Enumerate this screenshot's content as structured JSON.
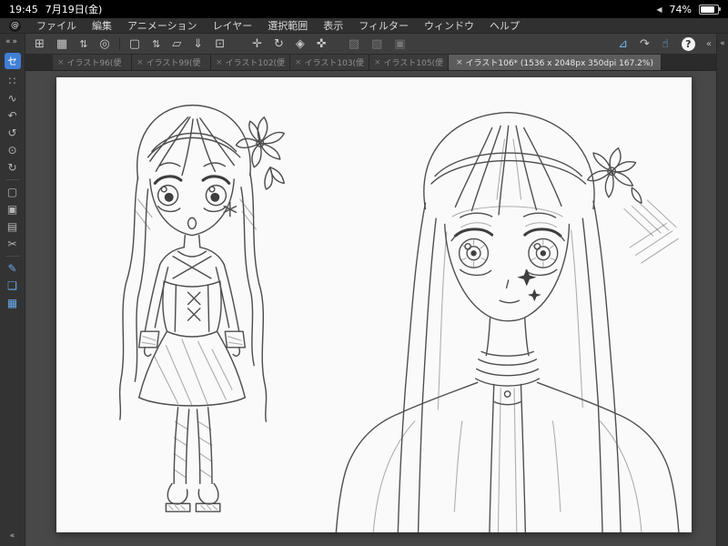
{
  "status_bar": {
    "time": "19:45",
    "date": "7月19日(金)",
    "side_icon": "◀",
    "battery_percent": "74%"
  },
  "menu_bar": {
    "logo_glyph": "@",
    "items": [
      "ファイル",
      "編集",
      "アニメーション",
      "レイヤー",
      "選択範囲",
      "表示",
      "フィルター",
      "ウィンドウ",
      "ヘルプ"
    ]
  },
  "toolbar": {
    "icons": [
      {
        "name": "window-layout-icon",
        "glyph": "⊞"
      },
      {
        "name": "checker-pattern-icon",
        "glyph": "▦"
      },
      {
        "name": "palette-stepper-icon",
        "glyph": "⇅"
      },
      {
        "name": "clip-studio-swirl-icon",
        "glyph": "◎"
      },
      {
        "name": "new-canvas-icon",
        "glyph": "▢"
      },
      {
        "name": "canvas-stepper-icon",
        "glyph": "⇅"
      },
      {
        "name": "open-file-icon",
        "glyph": "▱"
      },
      {
        "name": "save-file-icon",
        "glyph": "⇓"
      },
      {
        "name": "share-canvas-icon",
        "glyph": "⊡"
      },
      {
        "name": "move-tool-icon",
        "glyph": "✛"
      },
      {
        "name": "rotate-view-icon",
        "glyph": "↻"
      },
      {
        "name": "gradient-icon",
        "glyph": "◈"
      },
      {
        "name": "snap-icon",
        "glyph": "✜"
      },
      {
        "name": "snap-ruler-icon",
        "glyph": "▨"
      },
      {
        "name": "snap-grid-icon",
        "glyph": "▧"
      },
      {
        "name": "snap-special-icon",
        "glyph": "▣"
      },
      {
        "name": "vector-line-icon",
        "glyph": "⊿"
      },
      {
        "name": "curve-adjust-icon",
        "glyph": "↷"
      },
      {
        "name": "hand-tool-icon",
        "glyph": "☝"
      }
    ],
    "help_label": "?",
    "right_collapse": "«"
  },
  "tab_bar": {
    "close_glyph": "×",
    "tabs": [
      {
        "label": "イラスト96(便",
        "active": false
      },
      {
        "label": "イラスト99(便",
        "active": false
      },
      {
        "label": "イラスト102(便",
        "active": false
      },
      {
        "label": "イラスト103(便",
        "active": false
      },
      {
        "label": "イラスト105(便",
        "active": false
      },
      {
        "label": "イラスト106* (1536 x 2048px 350dpi 167.2%)",
        "active": true
      }
    ]
  },
  "sidebar": {
    "collapse": "«",
    "expand": "»",
    "badge": "セ",
    "tools": [
      {
        "name": "select-area-tool-icon",
        "glyph": "∷"
      },
      {
        "name": "lasso-tool-icon",
        "glyph": "∿"
      },
      {
        "name": "undo-tool-icon",
        "glyph": "↶"
      },
      {
        "name": "redo-tool-icon",
        "glyph": "↺"
      },
      {
        "name": "zoom-tool-icon",
        "glyph": "⊙"
      },
      {
        "name": "rotate-canvas-icon",
        "glyph": "↻"
      },
      {
        "name": "page-tool-icon",
        "glyph": "▢"
      },
      {
        "name": "reference-tool-icon",
        "glyph": "▣"
      },
      {
        "name": "material-tool-icon",
        "glyph": "▤"
      },
      {
        "name": "scissors-tool-icon",
        "glyph": "✂"
      },
      {
        "name": "pen-tool-icon",
        "glyph": "✎"
      },
      {
        "name": "layers-tool-icon",
        "glyph": "❏"
      },
      {
        "name": "color-set-tool-icon",
        "glyph": "▦"
      }
    ],
    "bottom_collapse": "«"
  },
  "right_rail": {
    "collapse": "«"
  },
  "colors": {
    "accent_blue": "#3f7fd6",
    "icon_blue": "#69a8e8",
    "toolbar_bg": "#3e3e3e",
    "canvas_bg": "#484848",
    "page_bg": "#fafafa",
    "sketch_stroke": "#4e4e4e"
  }
}
